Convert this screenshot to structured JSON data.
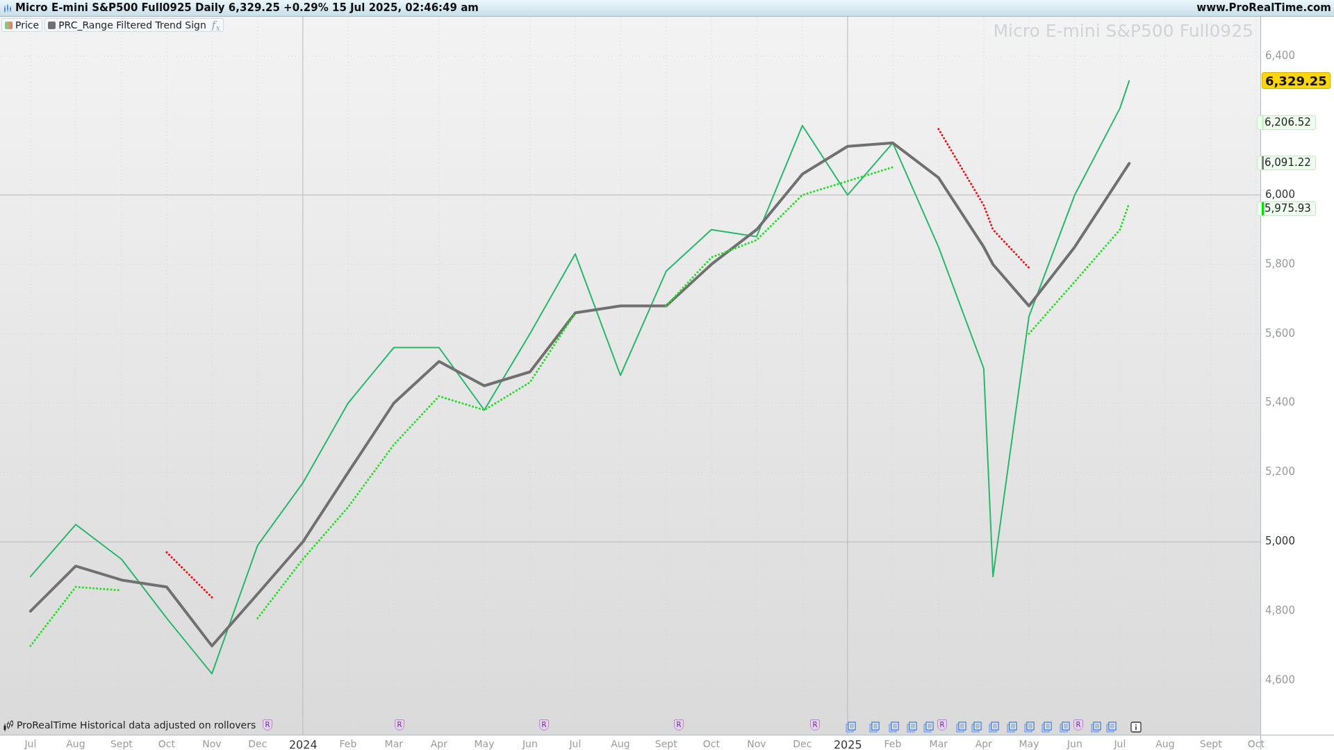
{
  "title_bar": {
    "title": "Micro E-mini S&P500 Full0925 Daily 6,329.25 +0.29% 15 Jul 2025, 02:46:49 am",
    "website": "www.ProRealTime.com"
  },
  "legend": [
    {
      "kind": "price"
    },
    {
      "kind": "indicator",
      "badge": "f$_{x}$"
    }
  ],
  "chart_title": "Micro E-mini S&P500 Full0925",
  "price_tags": [
    {
      "kind": "last",
      "label": "6,329.25",
      "color": "#ffd700"
    },
    {
      "kind": "level",
      "label": "6,206.52",
      "color": "#c8f5c8"
    },
    {
      "kind": "level",
      "label": "6,091.22",
      "color": "#808080"
    },
    {
      "kind": "level",
      "label": "5,975.93",
      "color": "#00e000"
    }
  ],
  "events": [
    {
      "kind": "rollover",
      "label": "R"
    },
    {
      "kind": "rollover",
      "label": "R"
    },
    {
      "kind": "rollover",
      "label": "R"
    },
    {
      "kind": "rollover",
      "label": "R"
    },
    {
      "kind": "rollover",
      "label": "R"
    },
    {
      "kind": "document"
    },
    {
      "kind": "document"
    },
    {
      "kind": "document"
    },
    {
      "kind": "document"
    },
    {
      "kind": "document"
    },
    {
      "kind": "rollover",
      "label": "R"
    },
    {
      "kind": "document"
    },
    {
      "kind": "document"
    },
    {
      "kind": "document"
    },
    {
      "kind": "document"
    },
    {
      "kind": "document"
    },
    {
      "kind": "document"
    },
    {
      "kind": "document"
    },
    {
      "kind": "rollover",
      "label": "R"
    },
    {
      "kind": "document"
    },
    {
      "kind": "document"
    },
    {
      "kind": "info"
    }
  ],
  "footer_note": "ProRealTime Historical data adjusted on rollovers",
  "chart_data": {
    "type": "line",
    "grid": true,
    "legend": "upper left",
    "x": [
      2023.5,
      2023.583,
      2023.667,
      2023.75,
      2023.833,
      2023.917,
      2024,
      2024.083,
      2024.167,
      2024.25,
      2024.333,
      2024.417,
      2024.5,
      2024.583,
      2024.667,
      2024.75,
      2024.833,
      2024.917,
      2025,
      2025.083,
      2025.167,
      2025.25,
      2025.267,
      2025.333,
      2025.417,
      2025.5,
      2025.517
    ],
    "series": [
      {
        "name": "Price",
        "color": "#26b86a",
        "line_style": "solid",
        "values": [
          4900,
          5050,
          4950,
          4780,
          4620,
          4990,
          5170,
          5400,
          5560,
          5560,
          5380,
          5600,
          5830,
          5480,
          5780,
          5900,
          5880,
          6200,
          6000,
          6150,
          5850,
          5500,
          4900,
          5650,
          6000,
          6250,
          6329
        ]
      },
      {
        "name": "PRC_Range Filtered Trend Sign",
        "color": "#707070",
        "line_style": "solid",
        "values": [
          4800,
          4930,
          4890,
          4870,
          4700,
          4850,
          5000,
          5200,
          5400,
          5520,
          5450,
          5490,
          5660,
          5680,
          5680,
          5800,
          5900,
          6060,
          6140,
          6150,
          6050,
          5850,
          5800,
          5680,
          5850,
          6050,
          6091
        ]
      },
      {
        "color": "#22dd22",
        "line_style": "dotted",
        "values": [
          4700,
          4870,
          4860,
          null,
          null,
          4780,
          4950,
          5100,
          5280,
          5420,
          5380,
          5460,
          5660,
          null,
          5680,
          5820,
          5870,
          6000,
          6040,
          6080,
          null,
          null,
          null,
          5600,
          5750,
          5900,
          5976
        ]
      },
      {
        "color": "#ee1111",
        "line_style": "dotted",
        "values": [
          null,
          null,
          null,
          4970,
          4840,
          null,
          null,
          null,
          null,
          null,
          null,
          null,
          null,
          null,
          null,
          null,
          null,
          null,
          null,
          null,
          6190,
          5970,
          5900,
          5790,
          null,
          null,
          null
        ]
      }
    ],
    "xlim": [
      2023.444,
      2025.893
    ],
    "ylim": [
      4444,
      6514
    ],
    "xticks": [
      {
        "value": 2023.5,
        "label": "Jul"
      },
      {
        "value": 2023.583,
        "label": "Aug"
      },
      {
        "value": 2023.667,
        "label": "Sept"
      },
      {
        "value": 2023.75,
        "label": "Oct"
      },
      {
        "value": 2023.833,
        "label": "Nov"
      },
      {
        "value": 2023.917,
        "label": "Dec"
      },
      {
        "value": 2024,
        "label": "2024"
      },
      {
        "value": 2024.083,
        "label": "Feb"
      },
      {
        "value": 2024.167,
        "label": "Mar"
      },
      {
        "value": 2024.25,
        "label": "Apr"
      },
      {
        "value": 2024.333,
        "label": "May"
      },
      {
        "value": 2024.417,
        "label": "Jun"
      },
      {
        "value": 2024.5,
        "label": "Jul"
      },
      {
        "value": 2024.583,
        "label": "Aug"
      },
      {
        "value": 2024.667,
        "label": "Sept"
      },
      {
        "value": 2024.75,
        "label": "Oct"
      },
      {
        "value": 2024.833,
        "label": "Nov"
      },
      {
        "value": 2024.917,
        "label": "Dec"
      },
      {
        "value": 2025,
        "label": "2025"
      },
      {
        "value": 2025.083,
        "label": "Feb"
      },
      {
        "value": 2025.167,
        "label": "Mar"
      },
      {
        "value": 2025.25,
        "label": "Apr"
      },
      {
        "value": 2025.333,
        "label": "May"
      },
      {
        "value": 2025.417,
        "label": "Jun"
      },
      {
        "value": 2025.5,
        "label": "Jul"
      },
      {
        "value": 2025.583,
        "label": "Aug"
      },
      {
        "value": 2025.667,
        "label": "Sept"
      },
      {
        "value": 2025.75,
        "label": "Oct"
      }
    ],
    "yticks": [
      {
        "value": 6400,
        "label": "6,400"
      },
      {
        "value": 6000,
        "label": "6,000"
      },
      {
        "value": 5800,
        "label": "5,800"
      },
      {
        "value": 5600,
        "label": "5,600"
      },
      {
        "value": 5400,
        "label": "5,400"
      },
      {
        "value": 5200,
        "label": "5,200"
      },
      {
        "value": 5000,
        "label": "5,000"
      },
      {
        "value": 4800,
        "label": "4,800"
      },
      {
        "value": 4600,
        "label": "4,600"
      }
    ]
  }
}
